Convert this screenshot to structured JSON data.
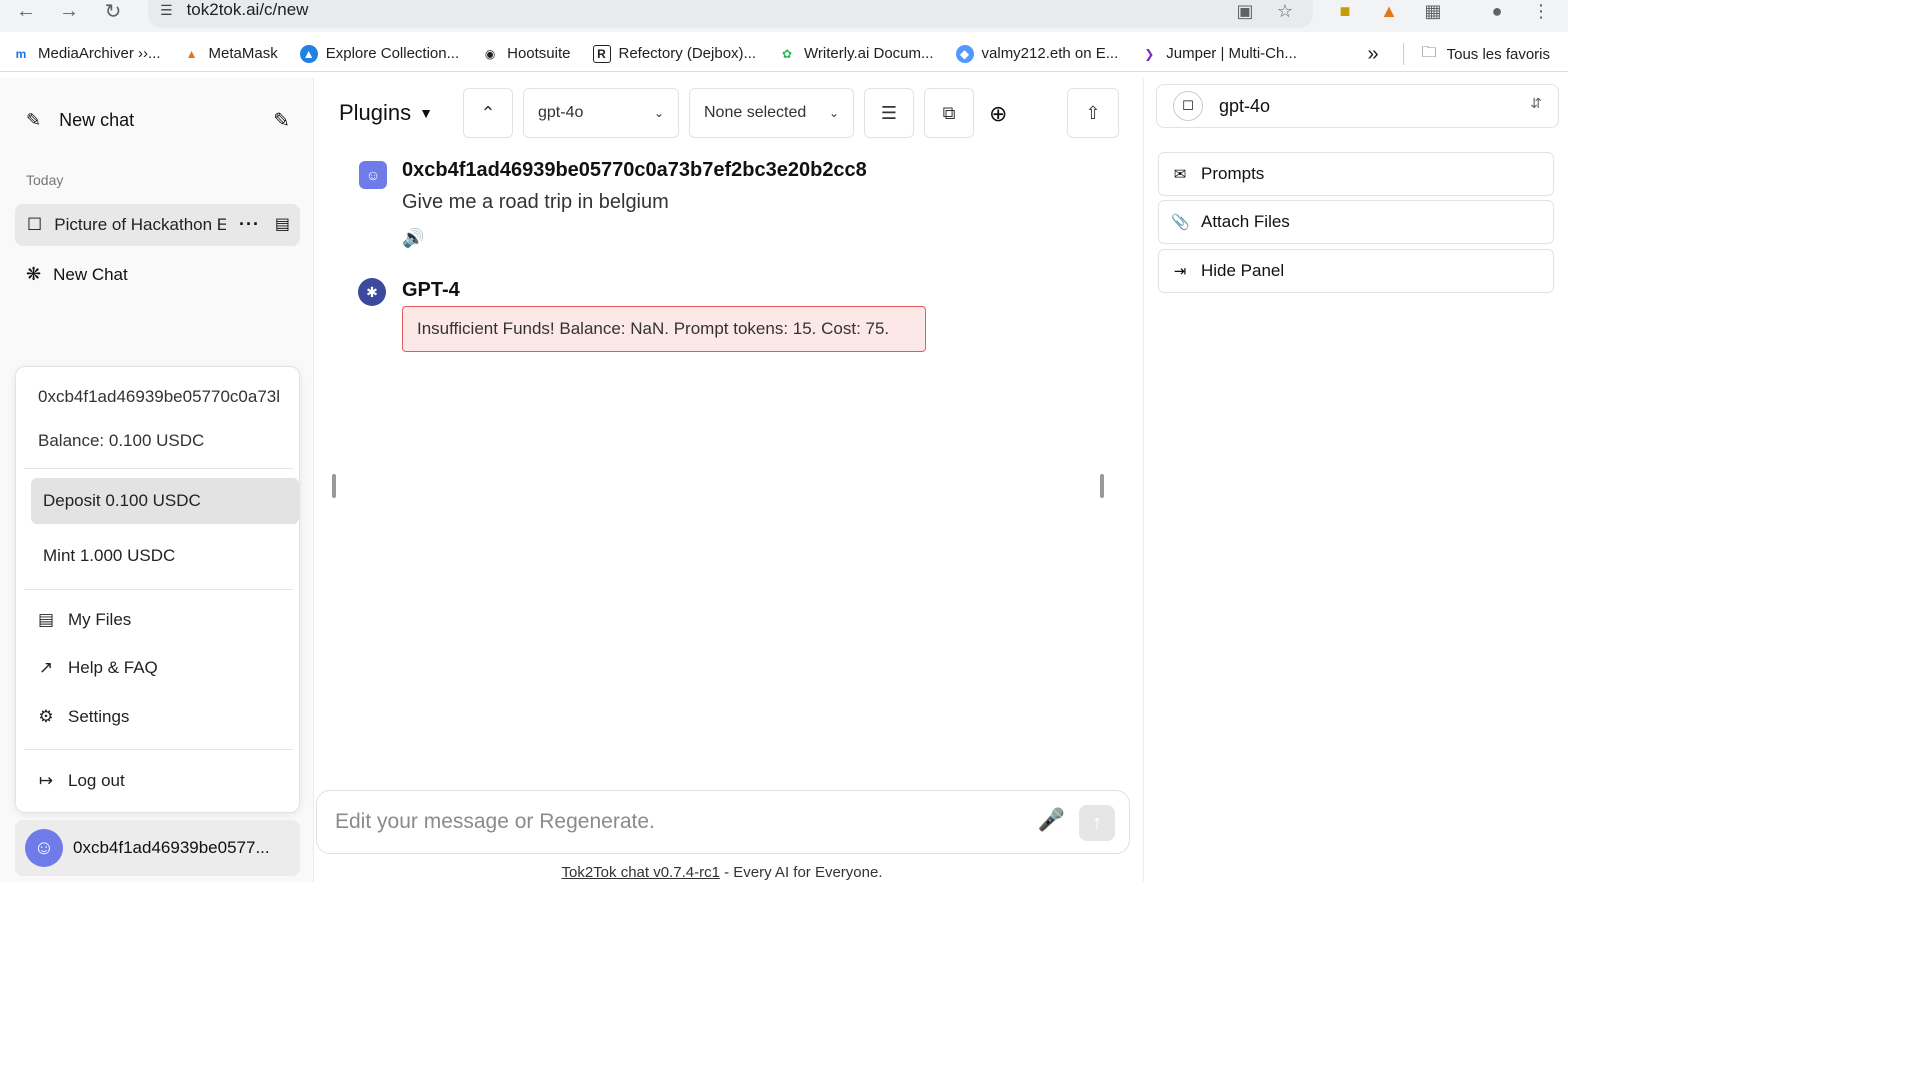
{
  "browser": {
    "url": "tok2tok.ai/c/new",
    "bookmarks": [
      {
        "label": "MediaArchiver ››...",
        "icon": "mediaarchiver-icon",
        "color": "#1a73e8"
      },
      {
        "label": "MetaMask",
        "icon": "metamask-icon",
        "color": "#e2761b"
      },
      {
        "label": "Explore Collection...",
        "icon": "opensea-icon",
        "color": "#2081e2"
      },
      {
        "label": "Hootsuite",
        "icon": "hootsuite-icon",
        "color": "#222222"
      },
      {
        "label": "Refectory (Dejbox)...",
        "icon": "refectory-icon",
        "color": "#222222"
      },
      {
        "label": "Writerly.ai Docum...",
        "icon": "writerly-icon",
        "color": "#2fb85a"
      },
      {
        "label": "valmy212.eth on E...",
        "icon": "ens-icon",
        "color": "#5298ff"
      },
      {
        "label": "Jumper | Multi-Ch...",
        "icon": "jumper-icon",
        "color": "#7b2cbf"
      }
    ],
    "more_label": "»",
    "all_bookmarks_label": "Tous les favoris"
  },
  "sidebar": {
    "new_chat_label": "New chat",
    "section_label": "Today",
    "conversations": [
      {
        "title": "Picture of Hackathon E",
        "active": true
      },
      {
        "title": "New Chat",
        "active": false
      }
    ],
    "account_menu": {
      "address": "0xcb4f1ad46939be05770c0a73l",
      "balance": "Balance: 0.100 USDC",
      "deposit_label": "Deposit 0.100 USDC",
      "mint_label": "Mint 1.000 USDC",
      "my_files_label": "My Files",
      "help_label": "Help & FAQ",
      "settings_label": "Settings",
      "logout_label": "Log out"
    },
    "user_label": "0xcb4f1ad46939be0577..."
  },
  "toolbar": {
    "plugins_label": "Plugins",
    "model_select": "gpt-4o",
    "plugins_select": "None selected"
  },
  "messages": [
    {
      "author": "0xcb4f1ad46939be05770c0a73b7ef2bc3e20b2cc8",
      "text": "Give me a road trip in belgium"
    },
    {
      "author": "GPT-4",
      "error": "Insufficient Funds! Balance: NaN. Prompt tokens: 15. Cost: 75."
    }
  ],
  "composer": {
    "placeholder": "Edit your message or Regenerate."
  },
  "footer": {
    "link_text": "Tok2Tok chat v0.7.4-rc1",
    "tagline": " - Every AI for Everyone."
  },
  "right_panel": {
    "model": "gpt-4o",
    "prompts_label": "Prompts",
    "attach_label": "Attach Files",
    "hide_label": "Hide Panel"
  },
  "colors": {
    "avatar_blue": "#6e7be8",
    "error_border": "#e25c5c",
    "error_bg": "#fde8e8"
  }
}
